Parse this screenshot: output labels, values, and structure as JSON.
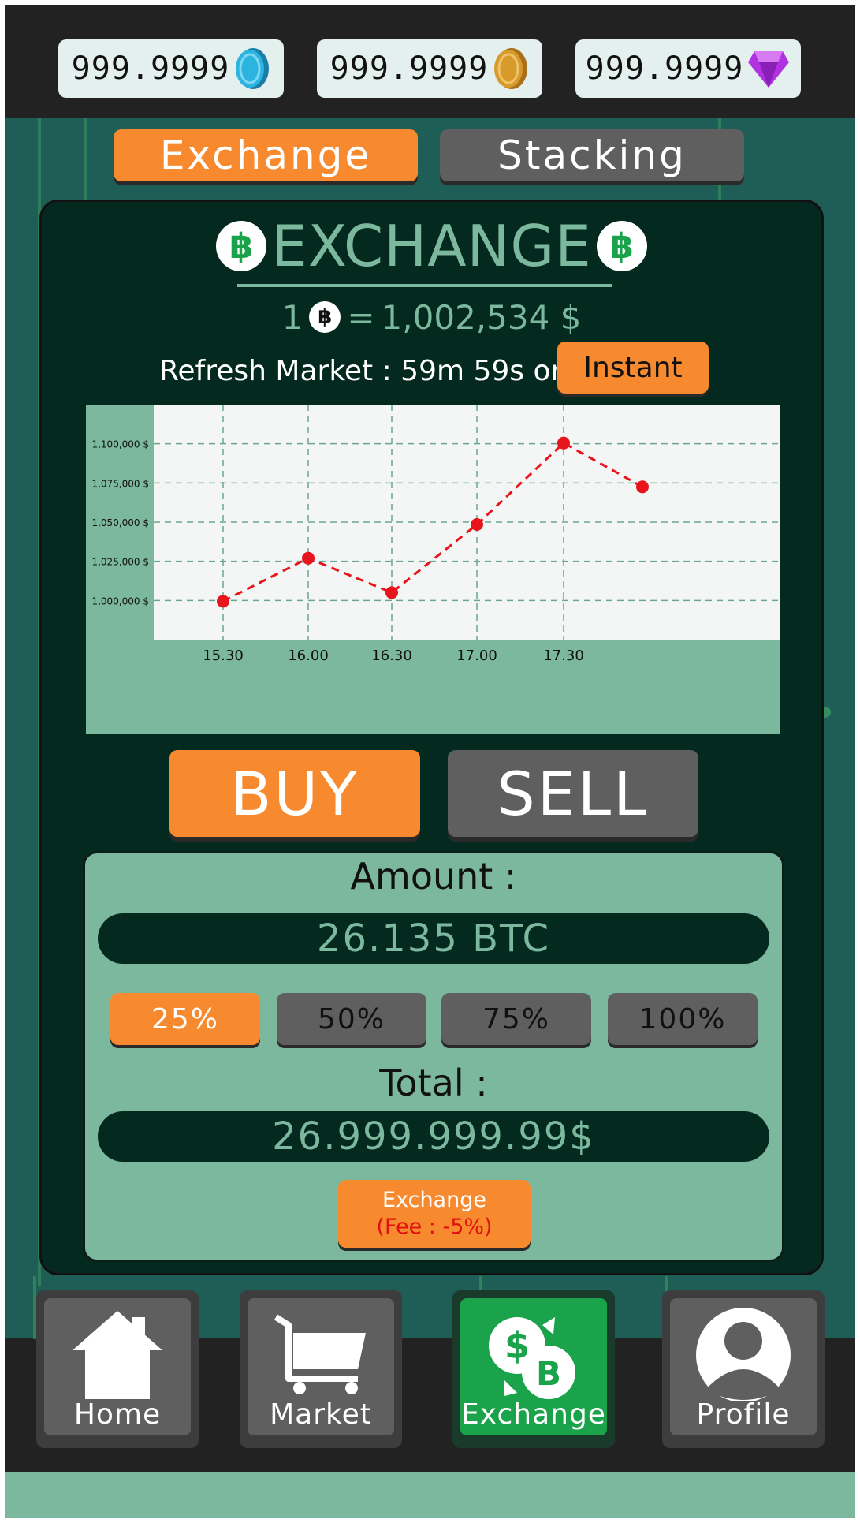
{
  "currencies": [
    {
      "value": "999.9999",
      "icon": "blue-gem-coin-icon",
      "color": "#2bb4e0"
    },
    {
      "value": "999.9999",
      "icon": "gold-coin-icon",
      "color": "#d89a2a"
    },
    {
      "value": "999.9999",
      "icon": "purple-diamond-icon",
      "color": "#b032e0"
    }
  ],
  "tabs": {
    "exchange": "Exchange",
    "stacking": "Stacking"
  },
  "header": {
    "title": "EXCHANGE",
    "coin_symbol": "฿"
  },
  "rate": {
    "amount": "1",
    "equals": "=",
    "price": "1,002,534 $"
  },
  "refresh": {
    "text": "Refresh Market : 59m 59s or",
    "button": "Instant"
  },
  "chart_data": {
    "type": "line",
    "x": [
      "15.30",
      "16.00",
      "16.30",
      "17.00",
      "17.30",
      ""
    ],
    "values": [
      999500,
      1027000,
      1005000,
      1048500,
      1100500,
      1072500
    ],
    "ytick_labels": [
      "1,100,000 $",
      "1,075,000 $",
      "1,050,000 $",
      "1,025,000 $",
      "1,000,000 $"
    ],
    "yticks": [
      1100000,
      1075000,
      1050000,
      1025000,
      1000000
    ],
    "ylim": [
      975000,
      1125000
    ],
    "grid": true,
    "color": "#e8141b"
  },
  "actions": {
    "buy": "BUY",
    "sell": "SELL"
  },
  "trade": {
    "amount_label": "Amount :",
    "amount_value": "26.135 BTC",
    "percents": [
      "25%",
      "50%",
      "75%",
      "100%"
    ],
    "selected_percent": "25%",
    "total_label": "Total :",
    "total_value": "26.999.999.99$",
    "exchange_button": "Exchange",
    "fee": "(Fee : -5%)"
  },
  "nav": [
    {
      "label": "Home",
      "icon": "home-icon"
    },
    {
      "label": "Market",
      "icon": "cart-icon"
    },
    {
      "label": "Exchange",
      "icon": "exchange-icon",
      "active": true
    },
    {
      "label": "Profile",
      "icon": "profile-icon"
    }
  ]
}
